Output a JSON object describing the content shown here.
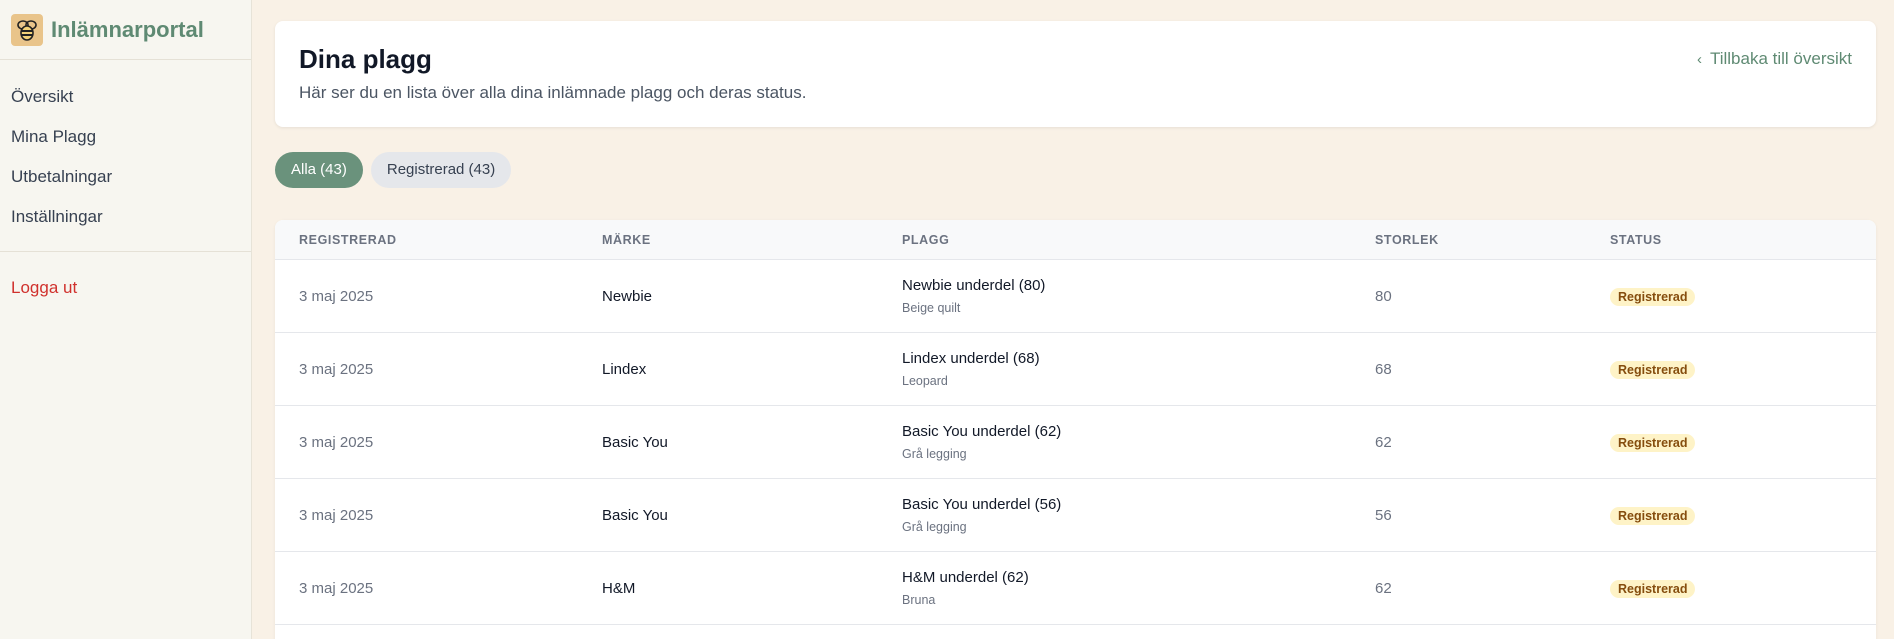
{
  "brand": {
    "title": "Inlämnarportal",
    "logo_icon": "bee-icon"
  },
  "sidebar": {
    "items": [
      {
        "label": "Översikt"
      },
      {
        "label": "Mina Plagg"
      },
      {
        "label": "Utbetalningar"
      },
      {
        "label": "Inställningar"
      }
    ],
    "logout_label": "Logga ut"
  },
  "header": {
    "title": "Dina plagg",
    "subtitle": "Här ser du en lista över alla dina inlämnade plagg och deras status.",
    "back_label": "Tillbaka till översikt"
  },
  "filters": [
    {
      "label": "Alla (43)",
      "active": true
    },
    {
      "label": "Registrerad (43)",
      "active": false
    }
  ],
  "table": {
    "columns": [
      "Registrerad",
      "Märke",
      "Plagg",
      "Storlek",
      "Status"
    ],
    "rows": [
      {
        "date": "3 maj 2025",
        "brand": "Newbie",
        "item": "Newbie underdel (80)",
        "desc": "Beige quilt",
        "size": "80",
        "status": "Registrerad"
      },
      {
        "date": "3 maj 2025",
        "brand": "Lindex",
        "item": "Lindex underdel (68)",
        "desc": "Leopard",
        "size": "68",
        "status": "Registrerad"
      },
      {
        "date": "3 maj 2025",
        "brand": "Basic You",
        "item": "Basic You underdel (62)",
        "desc": "Grå legging",
        "size": "62",
        "status": "Registrerad"
      },
      {
        "date": "3 maj 2025",
        "brand": "Basic You",
        "item": "Basic You underdel (56)",
        "desc": "Grå legging",
        "size": "56",
        "status": "Registrerad"
      },
      {
        "date": "3 maj 2025",
        "brand": "H&M",
        "item": "H&M underdel (62)",
        "desc": "Bruna",
        "size": "62",
        "status": "Registrerad"
      }
    ]
  },
  "colors": {
    "accent": "#5f8a73",
    "pill_active": "#6a927c",
    "logout": "#d0312d",
    "badge_bg": "#fef3c7",
    "badge_text": "#854d0e"
  }
}
